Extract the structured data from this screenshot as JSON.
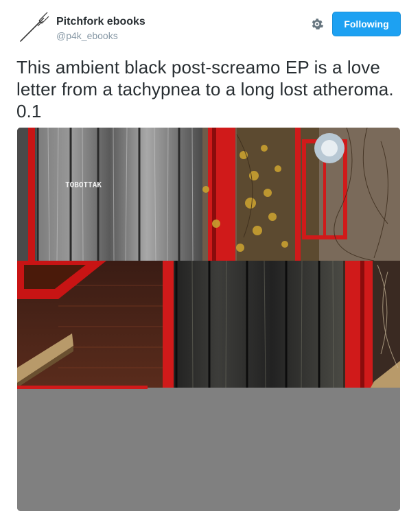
{
  "account": {
    "display_name": "Pitchfork ebooks",
    "handle": "@p4k_ebooks",
    "avatar_icon": "pitchfork-icon"
  },
  "actions": {
    "settings_icon": "gear-icon",
    "follow_label": "Following"
  },
  "tweet": {
    "text": "This ambient black post-screamo EP is a love letter from a tachypnea to a long lost atheroma. 0.1",
    "media_overlay_text": "TOBOTTAK"
  },
  "colors": {
    "follow_button": "#1da1f2",
    "handle_gray": "#8899a6",
    "media_gray": "#808080",
    "accent_red": "#d01a1a"
  }
}
